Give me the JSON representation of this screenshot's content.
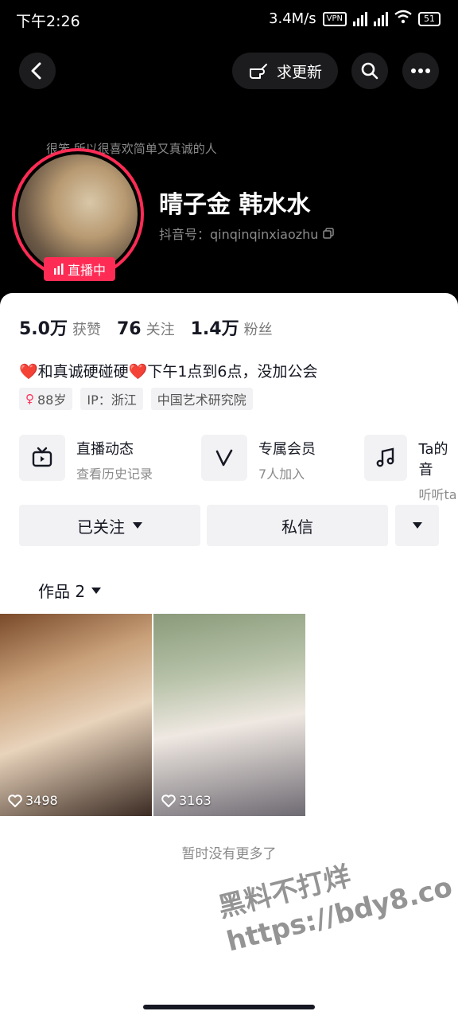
{
  "status_bar": {
    "time": "下午2:26",
    "speed": "3.4M/s",
    "vpn": "VPN",
    "battery": "51"
  },
  "nav": {
    "request_update_label": "求更新"
  },
  "profile": {
    "motto": "很笨 所以很喜欢简单又真诚的人",
    "live_badge": "直播中",
    "name": "晴子金 韩水水",
    "douyin_id": "抖音号：qinqinqinxiaozhu"
  },
  "stats": [
    {
      "num": "5.0万",
      "label": "获赞"
    },
    {
      "num": "76",
      "label": "关注"
    },
    {
      "num": "1.4万",
      "label": "粉丝"
    }
  ],
  "bio": "❤️和真诚硬碰硬❤️下午1点到6点，没加公会",
  "tags": {
    "age": "88岁",
    "ip": "IP：浙江",
    "school": "中国艺术研究院"
  },
  "features": [
    {
      "title": "直播动态",
      "subtitle": "查看历史记录"
    },
    {
      "title": "专属会员",
      "subtitle": "7人加入"
    },
    {
      "title": "Ta的音",
      "subtitle": "听听ta"
    }
  ],
  "actions": {
    "following": "已关注",
    "message": "私信"
  },
  "works": {
    "tab_label": "作品 2",
    "items": [
      {
        "likes": "3498"
      },
      {
        "likes": "3163"
      }
    ],
    "no_more": "暂时没有更多了"
  },
  "watermark": {
    "line1": "黑料不打烊",
    "line2": "https://bdy8.co"
  },
  "colors": {
    "accent": "#fe2c55",
    "header_bg": "#000000"
  }
}
